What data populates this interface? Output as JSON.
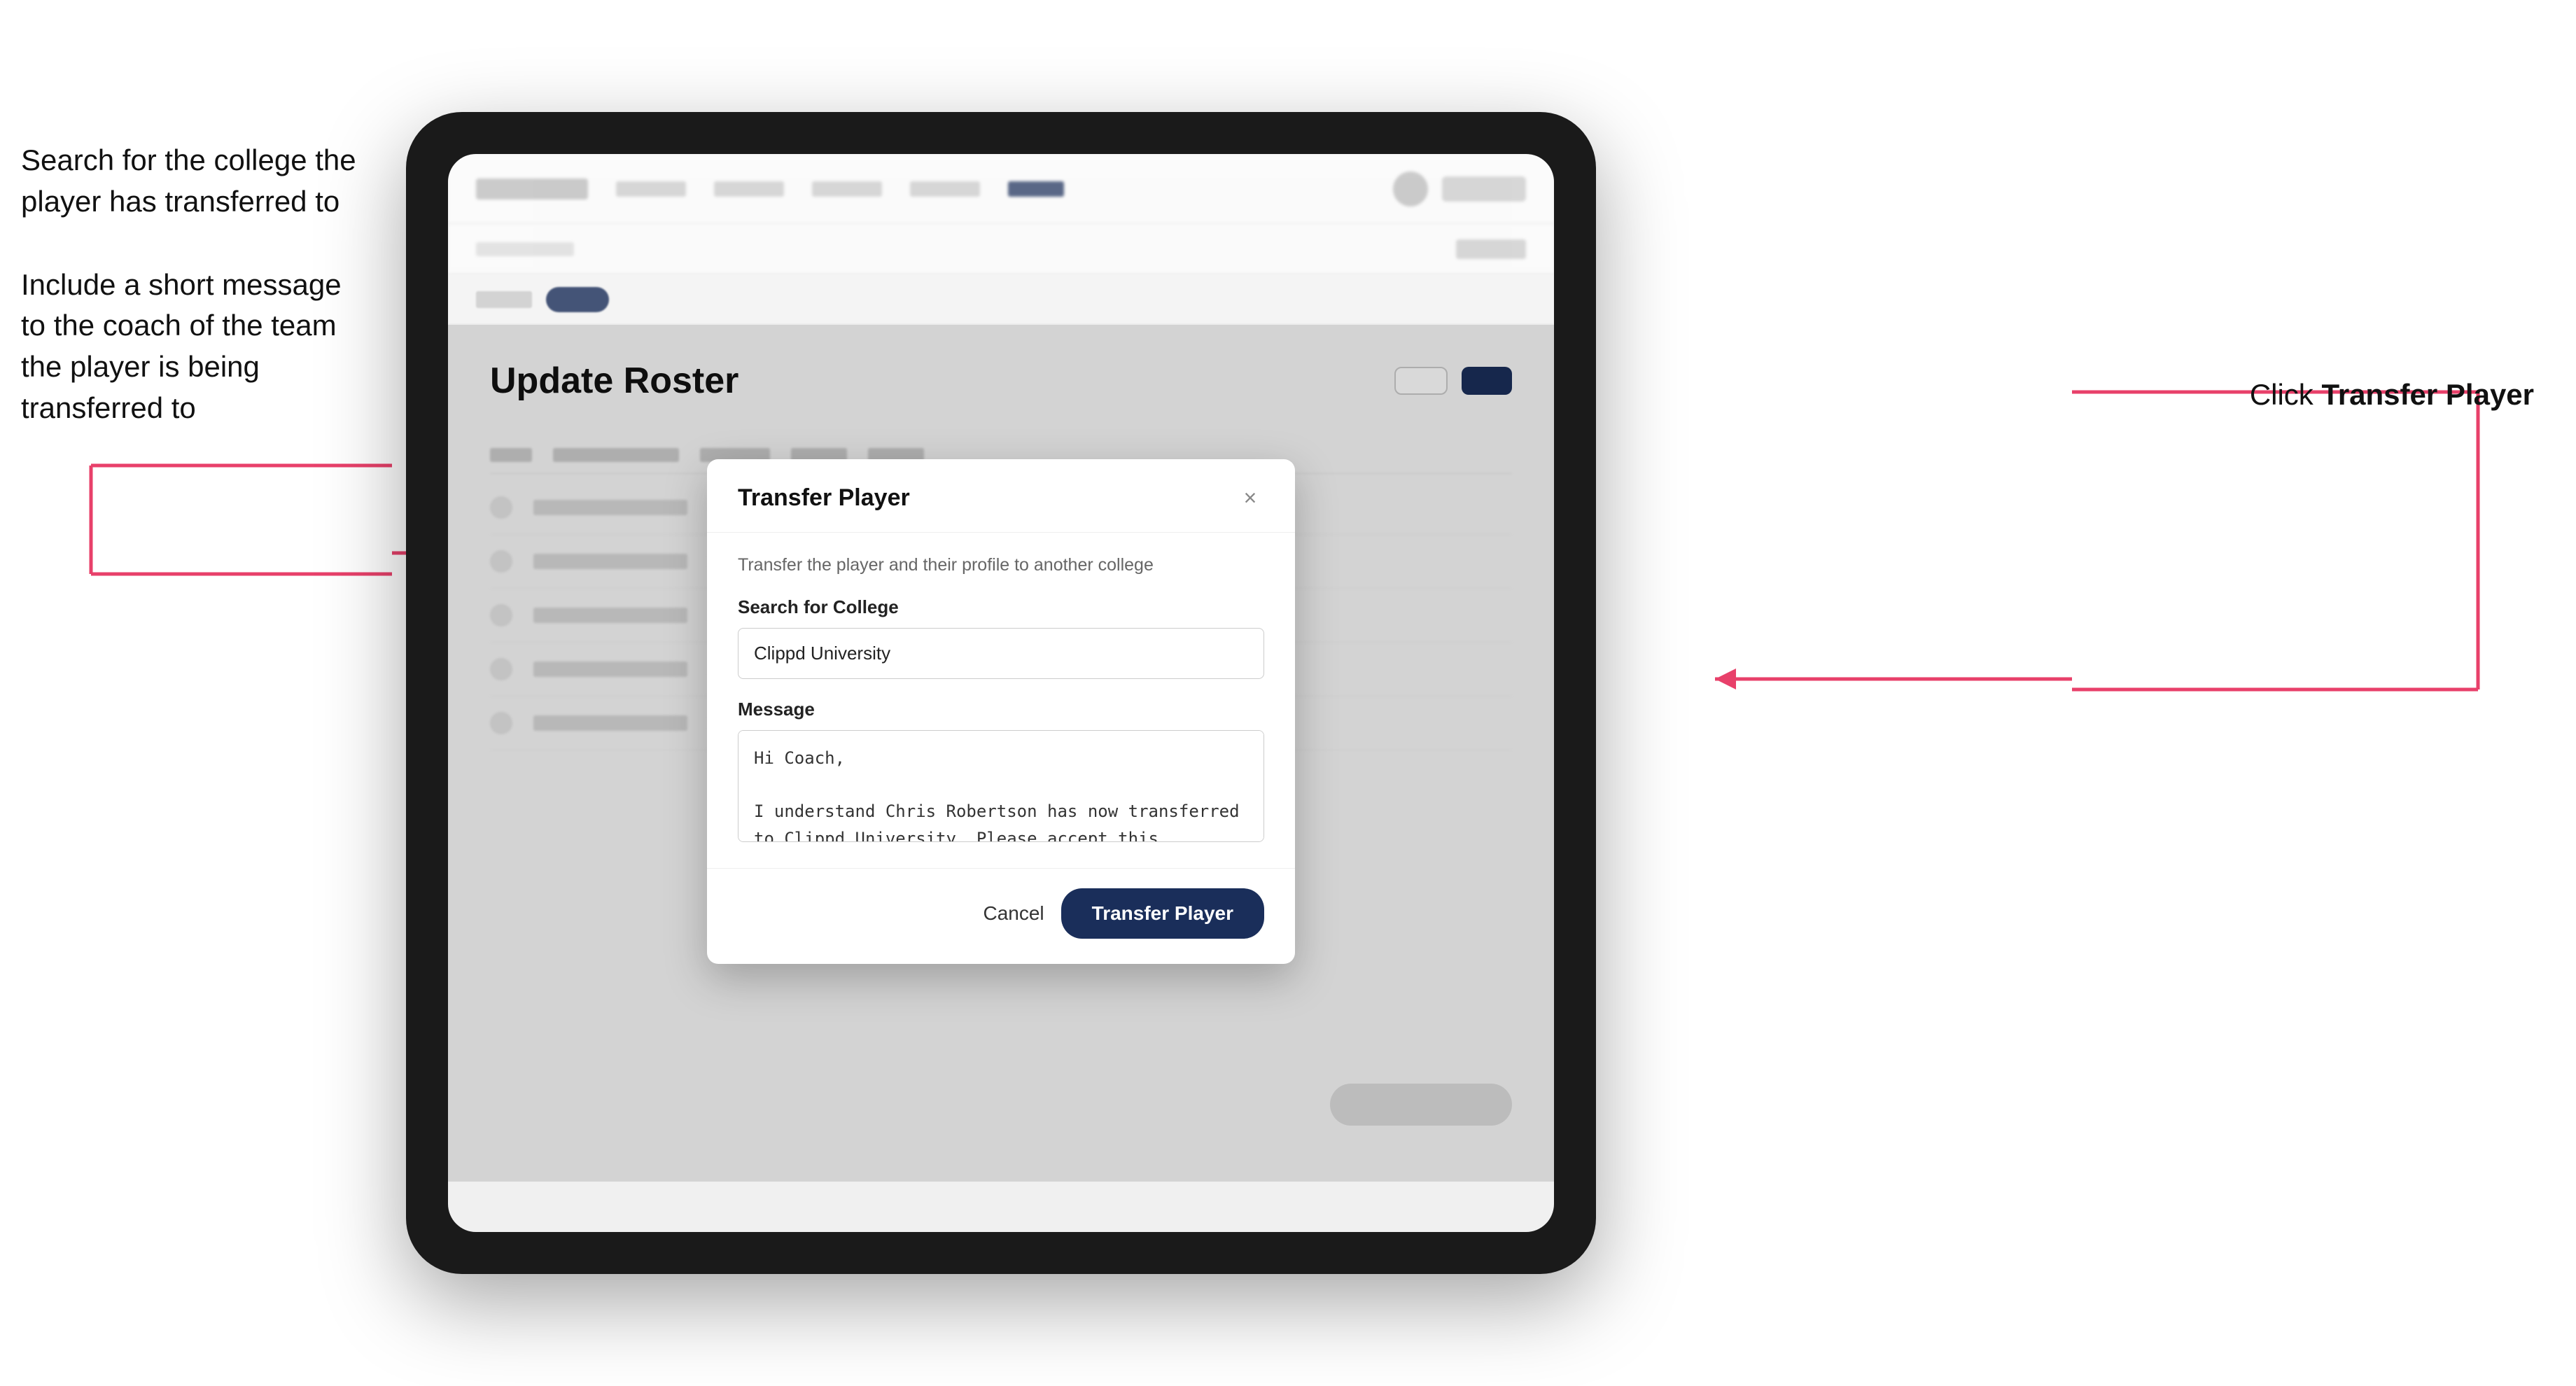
{
  "annotations": {
    "left_block1_line1": "Search for the college the",
    "left_block1_line2": "player has transferred to",
    "left_block2_line1": "Include a short message",
    "left_block2_line2": "to the coach of the team",
    "left_block2_line3": "the player is being",
    "left_block2_line4": "transferred to",
    "right_prefix": "Click ",
    "right_bold": "Transfer Player"
  },
  "modal": {
    "title": "Transfer Player",
    "subtitle": "Transfer the player and their profile to another college",
    "search_label": "Search for College",
    "search_value": "Clippd University",
    "message_label": "Message",
    "message_value": "Hi Coach,\n\nI understand Chris Robertson has now transferred to Clippd University. Please accept this transfer request when you can.",
    "cancel_label": "Cancel",
    "transfer_label": "Transfer Player"
  },
  "page": {
    "title": "Update Roster"
  }
}
